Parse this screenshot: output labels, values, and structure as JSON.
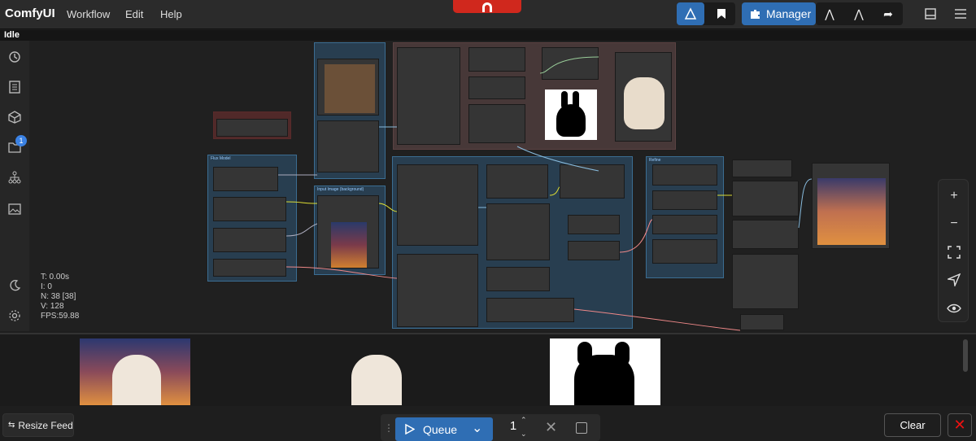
{
  "app": {
    "title": "ComfyUI"
  },
  "menu": {
    "workflow": "Workflow",
    "edit": "Edit",
    "help": "Help"
  },
  "toolbar": {
    "manager_label": "Manager"
  },
  "status": {
    "text": "Idle"
  },
  "sidebar": {
    "queue_badge": "1"
  },
  "stats": {
    "t": "T: 0.00s",
    "i": "I: 0",
    "n": "N: 38 [38]",
    "v": "V: 128",
    "fps": "FPS:59.88"
  },
  "nodes": {
    "group_a_title": "Flux Model",
    "group_b_title": "Input Image (background)",
    "group_c_title": "",
    "group_d_title": "Refine"
  },
  "feed": {
    "resize_label": "Resize Feed"
  },
  "queue": {
    "label": "Queue",
    "batch_count": "1"
  },
  "actions": {
    "clear_label": "Clear"
  },
  "colors": {
    "accent": "#2f6eb4",
    "red": "#d0281d"
  }
}
